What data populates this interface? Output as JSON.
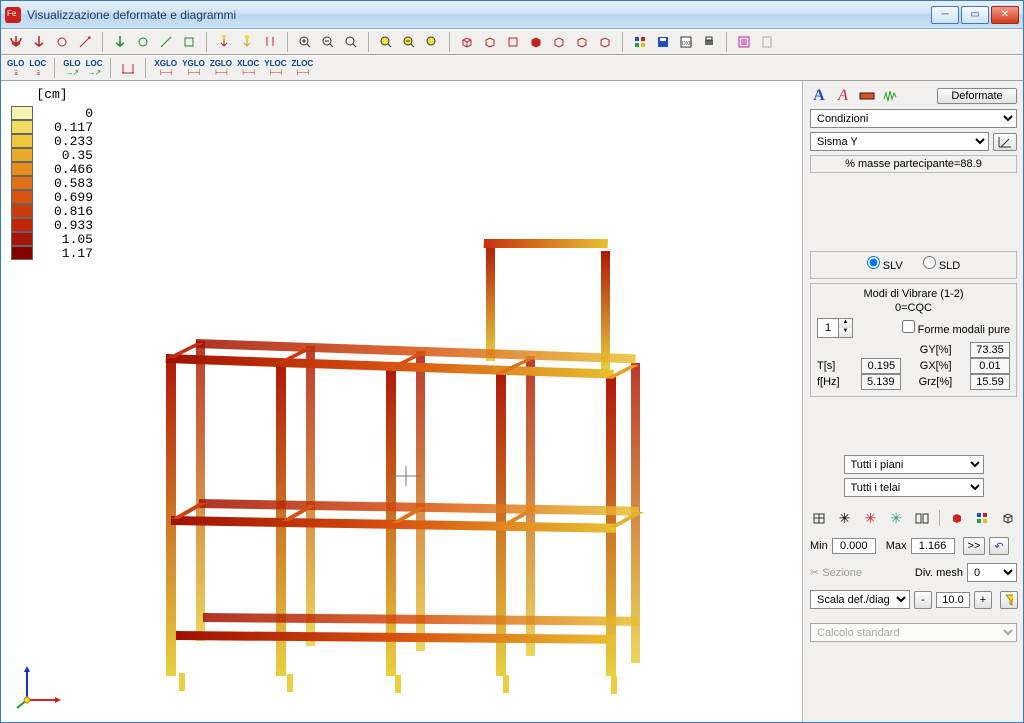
{
  "window": {
    "title": "Visualizzazione deformate e diagrammi"
  },
  "legend": {
    "unit": "[cm]",
    "rows": [
      {
        "c": "#f5f3b0",
        "v": "0"
      },
      {
        "c": "#f0dc63",
        "v": "0.117"
      },
      {
        "c": "#edc63b",
        "v": "0.233"
      },
      {
        "c": "#eaa92c",
        "v": "0.35"
      },
      {
        "c": "#e68e1d",
        "v": "0.466"
      },
      {
        "c": "#e06f16",
        "v": "0.583"
      },
      {
        "c": "#d6540e",
        "v": "0.699"
      },
      {
        "c": "#cc3b0a",
        "v": "0.816"
      },
      {
        "c": "#c22507",
        "v": "0.933"
      },
      {
        "c": "#a51404",
        "v": "1.05"
      },
      {
        "c": "#860000",
        "v": "1.17"
      }
    ]
  },
  "panel": {
    "deformate_btn": "Deformate",
    "dropdown_condizioni": "Condizioni",
    "dropdown_sisma": "Sisma Y",
    "masse": "% masse partecipante=88.9",
    "radio_slv": "SLV",
    "radio_sld": "SLD",
    "modi_title1": "Modi di Vibrare (1-2)",
    "modi_title2": "0=CQC",
    "mode_num": "1",
    "forme_label": "Forme modali pure",
    "T_label": "T[s]",
    "T_val": "0.195",
    "f_label": "f[Hz]",
    "f_val": "5.139",
    "GY_label": "GY[%]",
    "GY_val": "73.35",
    "GX_label": "GX[%]",
    "GX_val": "0.01",
    "Grz_label": "Grz[%]",
    "Grz_val": "15.59",
    "tutti_piani": "Tutti i piani",
    "tutti_telai": "Tutti i telai",
    "min_label": "Min",
    "min_val": "0.000",
    "max_label": "Max",
    "max_val": "1.166",
    "go_btn": ">>",
    "sezione_label": "Sezione",
    "divmesh_label": "Div. mesh",
    "divmesh_val": "0",
    "scala_label": "Scala def./diag.",
    "scala_minus": "-",
    "scala_val": "10.0",
    "scala_plus": "+",
    "calc_std": "Calcolo standard"
  },
  "toolbar2": {
    "glo": "GLO",
    "loc": "LOC",
    "xglo": "XGLO",
    "yglo": "YGLO",
    "zglo": "ZGLO",
    "xloc": "XLOC",
    "yloc": "YLOC",
    "zloc": "ZLOC"
  }
}
